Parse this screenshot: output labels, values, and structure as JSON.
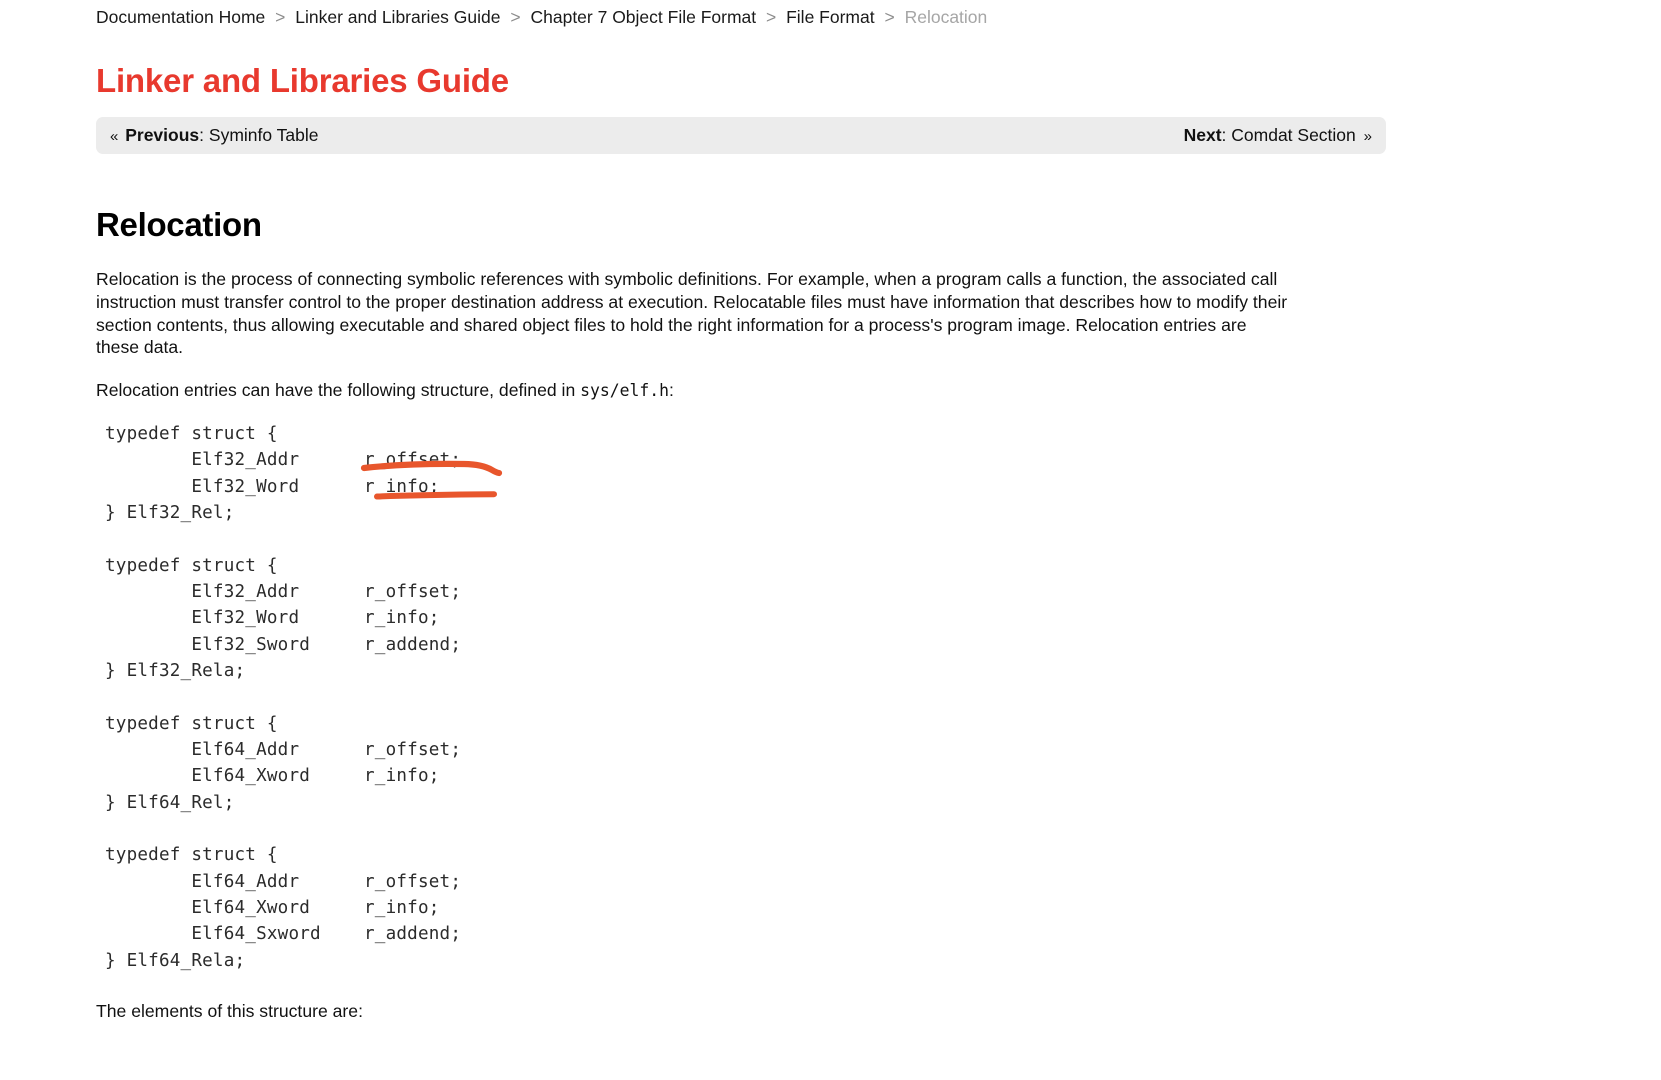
{
  "breadcrumb": {
    "separator": ">",
    "items": [
      {
        "label": "Documentation Home",
        "current": false
      },
      {
        "label": "Linker and Libraries Guide",
        "current": false
      },
      {
        "label": "Chapter 7 Object File Format",
        "current": false
      },
      {
        "label": "File Format",
        "current": false
      },
      {
        "label": "Relocation",
        "current": true
      }
    ]
  },
  "site": {
    "title": "Linker and Libraries Guide",
    "title_color": "#e8392e"
  },
  "navbar": {
    "prev_chevron": "«",
    "prev_label": "Previous",
    "prev_separator": ": ",
    "prev_target": "Syminfo Table",
    "next_label": "Next",
    "next_separator": ": ",
    "next_target": "Comdat Section",
    "next_chevron": "»",
    "background": "#ececec"
  },
  "main": {
    "heading": "Relocation",
    "paragraph_1": "Relocation is the process of connecting symbolic references with symbolic definitions. For example, when a program calls a function, the associated call instruction must transfer control to the proper destination address at execution. Relocatable files must have information that describes how to modify their section contents, thus allowing executable and shared object files to hold the right information for a process's program image. Relocation entries are these data.",
    "paragraph_2_prefix": "Relocation entries can have the following structure, defined in",
    "paragraph_2_mono": "sys/elf.h",
    "paragraph_2_suffix": ":",
    "closing_line": "The elements of this structure are:",
    "code_blocks": [
      "typedef struct {\n        Elf32_Addr      r_offset;\n        Elf32_Word      r_info;\n} Elf32_Rel;",
      "typedef struct {\n        Elf32_Addr      r_offset;\n        Elf32_Word      r_info;\n        Elf32_Sword     r_addend;\n} Elf32_Rela;",
      "typedef struct {\n        Elf64_Addr      r_offset;\n        Elf64_Xword     r_info;\n} Elf64_Rel;",
      "typedef struct {\n        Elf64_Addr      r_offset;\n        Elf64_Xword     r_info;\n        Elf64_Sxword    r_addend;\n} Elf64_Rela;"
    ]
  },
  "annotations": {
    "color": "#e8562c",
    "marks": [
      {
        "name": "underline-r-offset",
        "shape": "wavy-stroke"
      },
      {
        "name": "underline-r-info",
        "shape": "straight-stroke"
      }
    ]
  }
}
